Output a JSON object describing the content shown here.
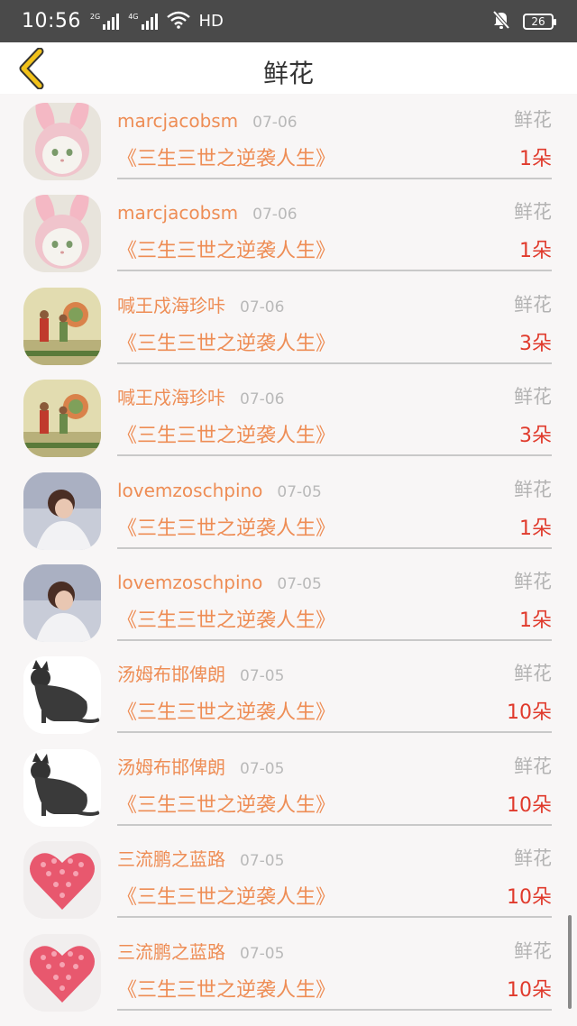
{
  "status_bar": {
    "time": "10:56",
    "net1": "2G",
    "net2": "4G",
    "hd": "HD",
    "battery": "26"
  },
  "header": {
    "title": "鲜花"
  },
  "items": [
    {
      "username": "marcjacobsm",
      "date": "07-06",
      "gift": "鲜花",
      "book": "《三生三世之逆袭人生》",
      "count": "1朵",
      "avatar": "bunny-cat"
    },
    {
      "username": "marcjacobsm",
      "date": "07-06",
      "gift": "鲜花",
      "book": "《三生三世之逆袭人生》",
      "count": "1朵",
      "avatar": "bunny-cat"
    },
    {
      "username": "喊王戍海珍咔",
      "date": "07-06",
      "gift": "鲜花",
      "book": "《三生三世之逆袭人生》",
      "count": "3朵",
      "avatar": "painting"
    },
    {
      "username": "喊王戍海珍咔",
      "date": "07-06",
      "gift": "鲜花",
      "book": "《三生三世之逆袭人生》",
      "count": "3朵",
      "avatar": "painting"
    },
    {
      "username": "lovemzoschpino",
      "date": "07-05",
      "gift": "鲜花",
      "book": "《三生三世之逆袭人生》",
      "count": "1朵",
      "avatar": "person"
    },
    {
      "username": "lovemzoschpino",
      "date": "07-05",
      "gift": "鲜花",
      "book": "《三生三世之逆袭人生》",
      "count": "1朵",
      "avatar": "person"
    },
    {
      "username": "汤姆布邯俾朗",
      "date": "07-05",
      "gift": "鲜花",
      "book": "《三生三世之逆袭人生》",
      "count": "10朵",
      "avatar": "black-cat"
    },
    {
      "username": "汤姆布邯俾朗",
      "date": "07-05",
      "gift": "鲜花",
      "book": "《三生三世之逆袭人生》",
      "count": "10朵",
      "avatar": "black-cat"
    },
    {
      "username": "三流鹏之蓝路",
      "date": "07-05",
      "gift": "鲜花",
      "book": "《三生三世之逆袭人生》",
      "count": "10朵",
      "avatar": "heart"
    },
    {
      "username": "三流鹏之蓝路",
      "date": "07-05",
      "gift": "鲜花",
      "book": "《三生三世之逆袭人生》",
      "count": "10朵",
      "avatar": "heart"
    }
  ],
  "colors": {
    "accent": "#ee8d55",
    "count": "#e03a2c",
    "muted": "#b3b3b3",
    "back_icon": "#f2c21a"
  }
}
